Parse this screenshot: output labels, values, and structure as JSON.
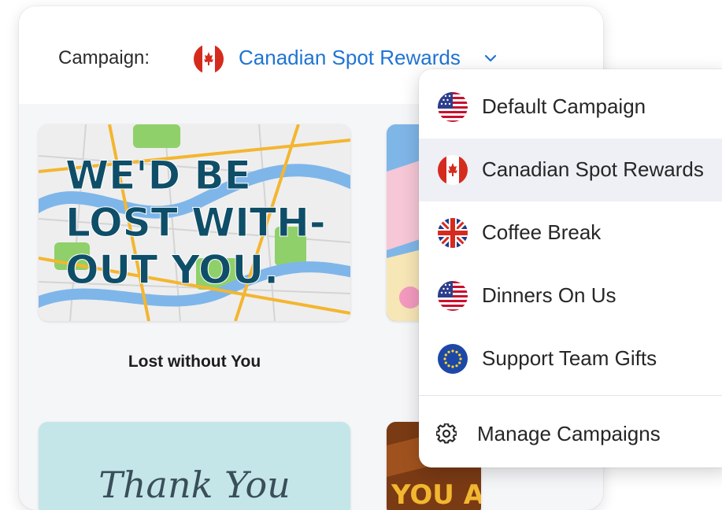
{
  "header": {
    "campaign_label": "Campaign:",
    "selected_campaign": "Canadian Spot Rewards",
    "selected_flag": "canada-flag-icon"
  },
  "cards": [
    {
      "caption": "Lost without You",
      "art_text_lines": [
        "WE'D BE",
        "LOST WITH-",
        "OUT YOU."
      ]
    },
    {
      "caption": "",
      "art_text": "Thank You"
    },
    {
      "art_text": "YOU AR"
    }
  ],
  "dropdown": {
    "items": [
      {
        "label": "Default Campaign",
        "flag": "usa-flag-icon",
        "active": false
      },
      {
        "label": "Canadian Spot Rewards",
        "flag": "canada-flag-icon",
        "active": true
      },
      {
        "label": "Coffee Break",
        "flag": "uk-flag-icon",
        "active": false
      },
      {
        "label": "Dinners On Us",
        "flag": "usa-flag-icon",
        "active": false
      },
      {
        "label": "Support Team Gifts",
        "flag": "eu-flag-icon",
        "active": false
      }
    ],
    "manage_label": "Manage Campaigns"
  },
  "colors": {
    "accent": "#1f74d4",
    "active_row": "#eef0f5",
    "panel_bg": "#f5f6f8"
  }
}
